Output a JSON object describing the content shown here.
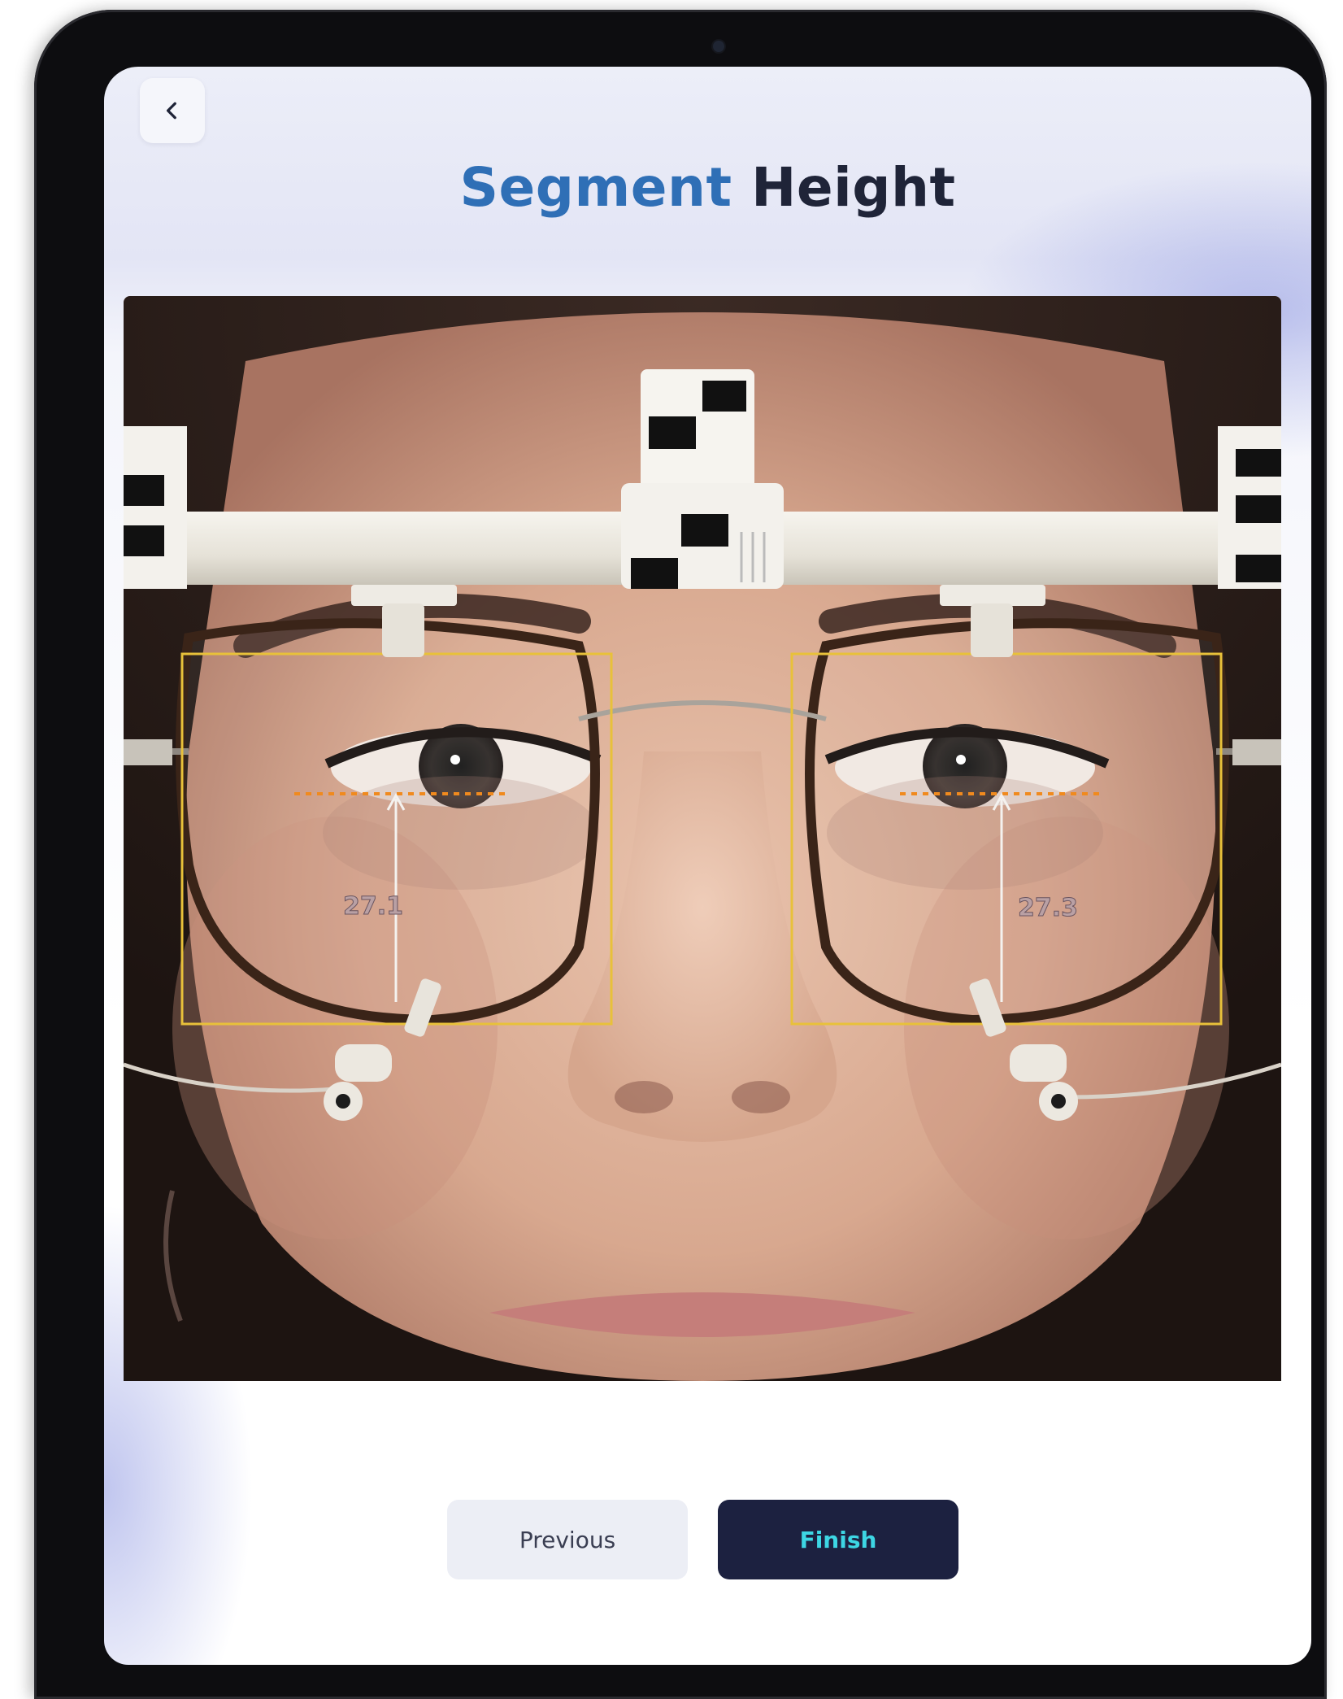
{
  "header": {
    "back_icon": "chevron-left-icon",
    "title_accent": "Segment",
    "title_rest": "Height"
  },
  "capture": {
    "left_eye_segment_height": "27.1",
    "right_eye_segment_height": "27.3"
  },
  "actions": {
    "previous_label": "Previous",
    "finish_label": "Finish"
  },
  "colors": {
    "title_accent": "#2f6fb6",
    "title_text": "#1f2438",
    "finish_bg": "#1c2140",
    "finish_text": "#3dd6e4",
    "previous_bg": "#eceef5",
    "frame_box": "#e8c13a",
    "pupil_line": "#f08a1e"
  }
}
